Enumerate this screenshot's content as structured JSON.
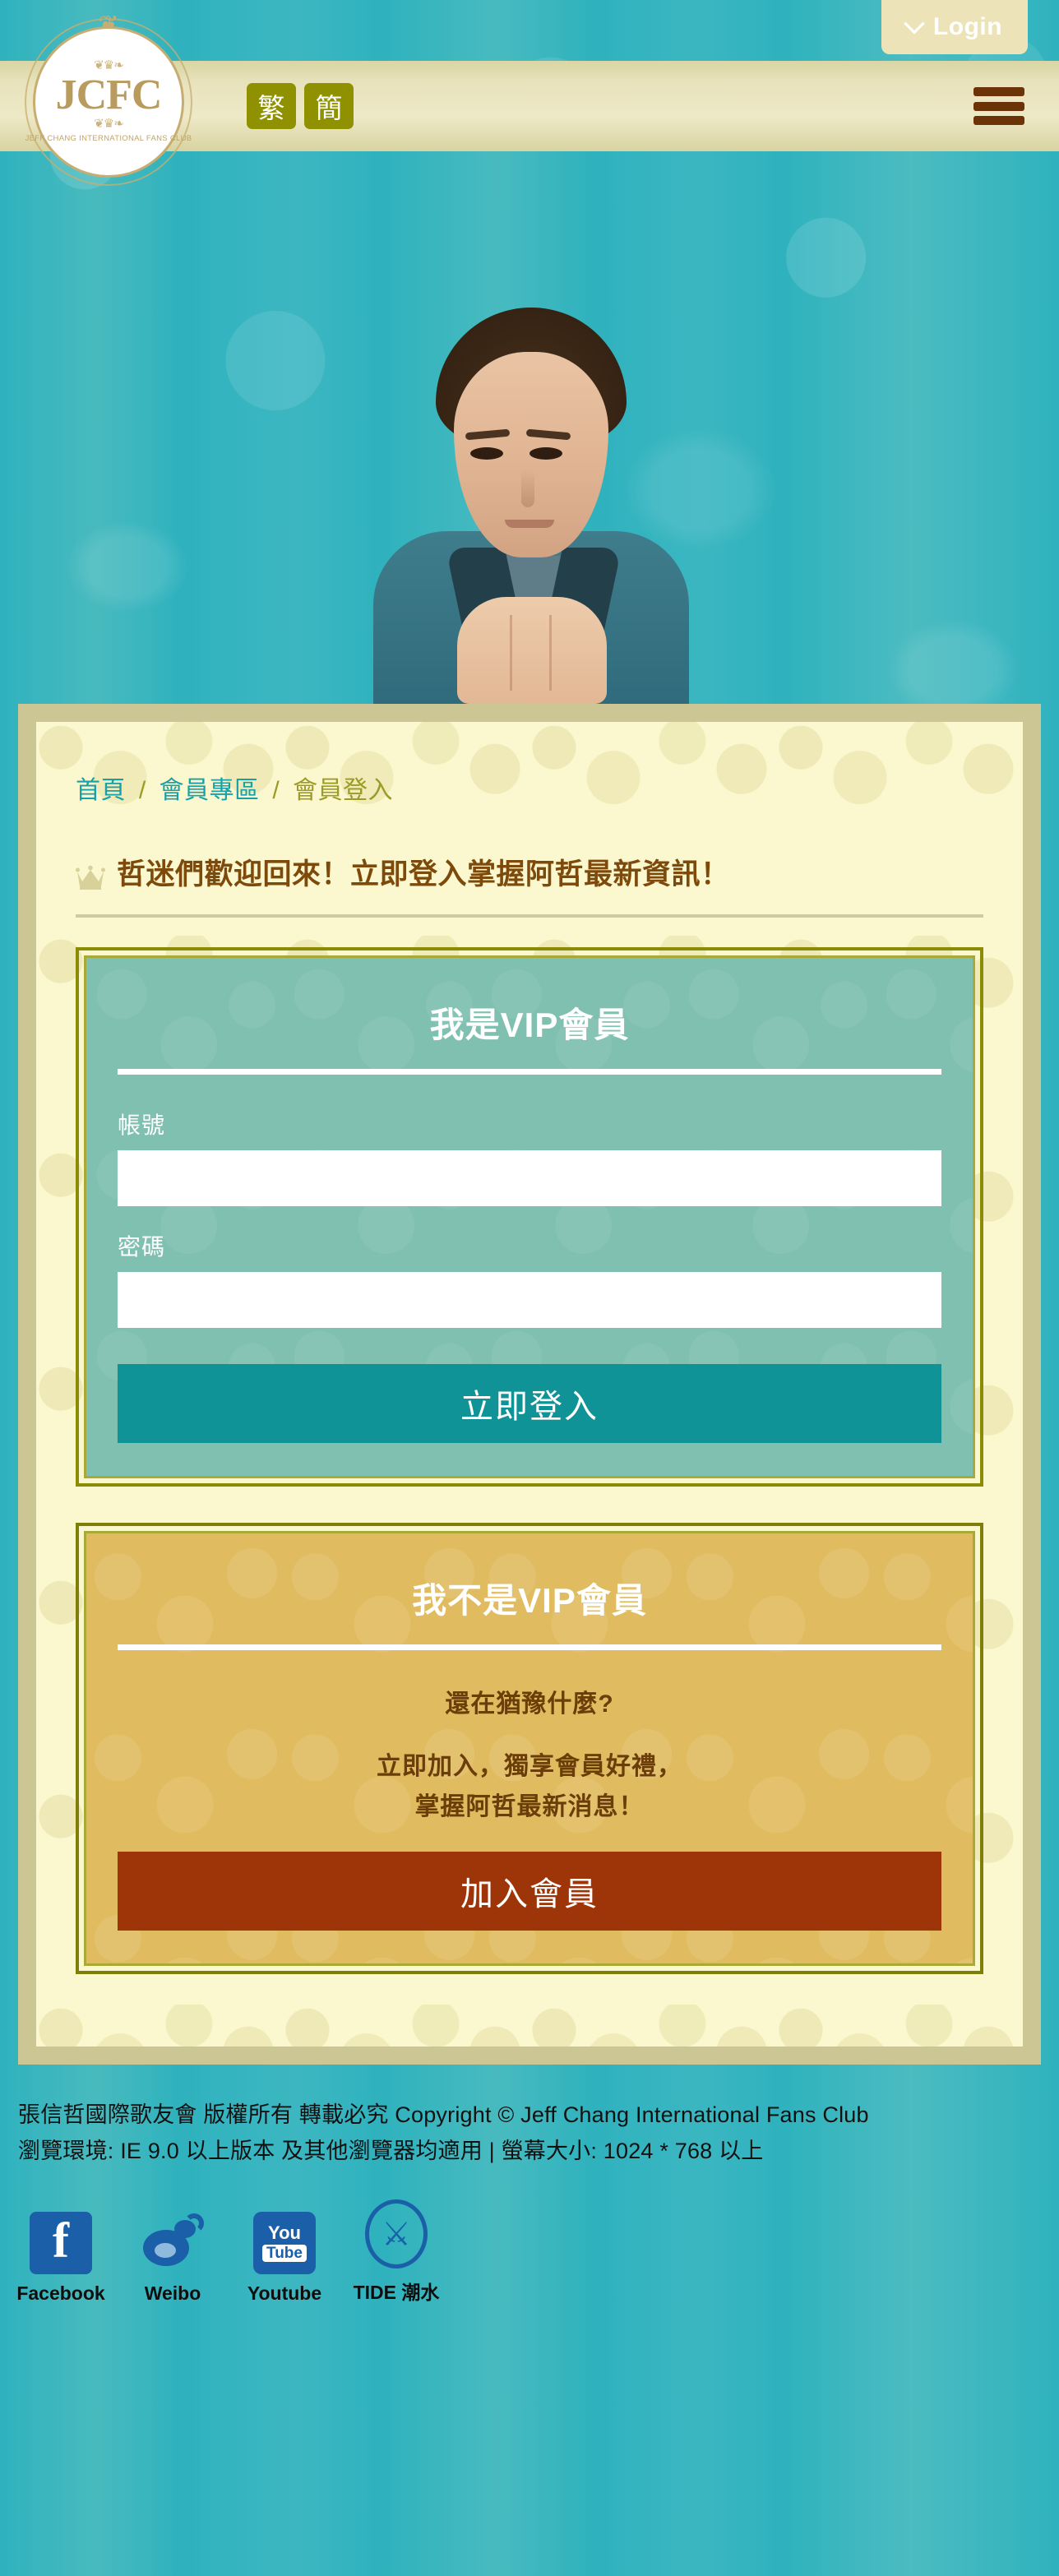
{
  "topbar": {
    "login_label": "Login",
    "chevron_icon": "chevron-down-icon"
  },
  "header": {
    "logo_mark": "JCFC",
    "logo_subtitle": "JEFF CHANG INTERNATIONAL FANS CLUB",
    "lang_traditional": "繁",
    "lang_simplified": "簡",
    "menu_icon": "hamburger-menu-icon"
  },
  "breadcrumb": {
    "home": "首頁",
    "sep1": "/",
    "member_zone": "會員專區",
    "sep2": "/",
    "current": "會員登入"
  },
  "welcome": {
    "crown_icon": "crown-icon",
    "title": "哲迷們歡迎回來！立即登入掌握阿哲最新資訊！"
  },
  "vip_panel": {
    "title": "我是VIP會員",
    "account_label": "帳號",
    "account_value": "",
    "account_placeholder": "",
    "password_label": "密碼",
    "password_value": "",
    "password_placeholder": "",
    "login_button": "立即登入",
    "bg_color": "#7fc0b0",
    "border_color": "#8a8c06",
    "button_color": "#0f9396"
  },
  "nonvip_panel": {
    "title": "我不是VIP會員",
    "promo_lead": "還在猶豫什麼?",
    "promo_line1": "立即加入，獨享會員好禮，",
    "promo_line2": "掌握阿哲最新消息！",
    "join_button": "加入會員",
    "bg_color": "#e0bb5f",
    "border_color": "#7d7f08",
    "button_color": "#9e3509"
  },
  "footer": {
    "copyright": "張信哲國際歌友會 版權所有 轉載必究 Copyright © Jeff Chang International Fans Club",
    "browser_note": "瀏覽環境: IE 9.0 以上版本 及其他瀏覽器均適用 | 螢幕大小: 1024 * 768 以上",
    "socials": [
      {
        "icon": "facebook-icon",
        "label": "Facebook"
      },
      {
        "icon": "weibo-icon",
        "label": "Weibo"
      },
      {
        "icon": "youtube-icon",
        "label": "Youtube"
      },
      {
        "icon": "tide-icon",
        "label": "TIDE 潮水"
      }
    ]
  },
  "theme": {
    "page_bg": "#2fb2be",
    "header_band": "#e8e3bd",
    "panel_outer": "#cbc693",
    "panel_inner": "#fbf8cf",
    "link_color": "#17a0a8",
    "accent_olive": "#9c9b25",
    "heading_brown": "#7e4a0b"
  }
}
